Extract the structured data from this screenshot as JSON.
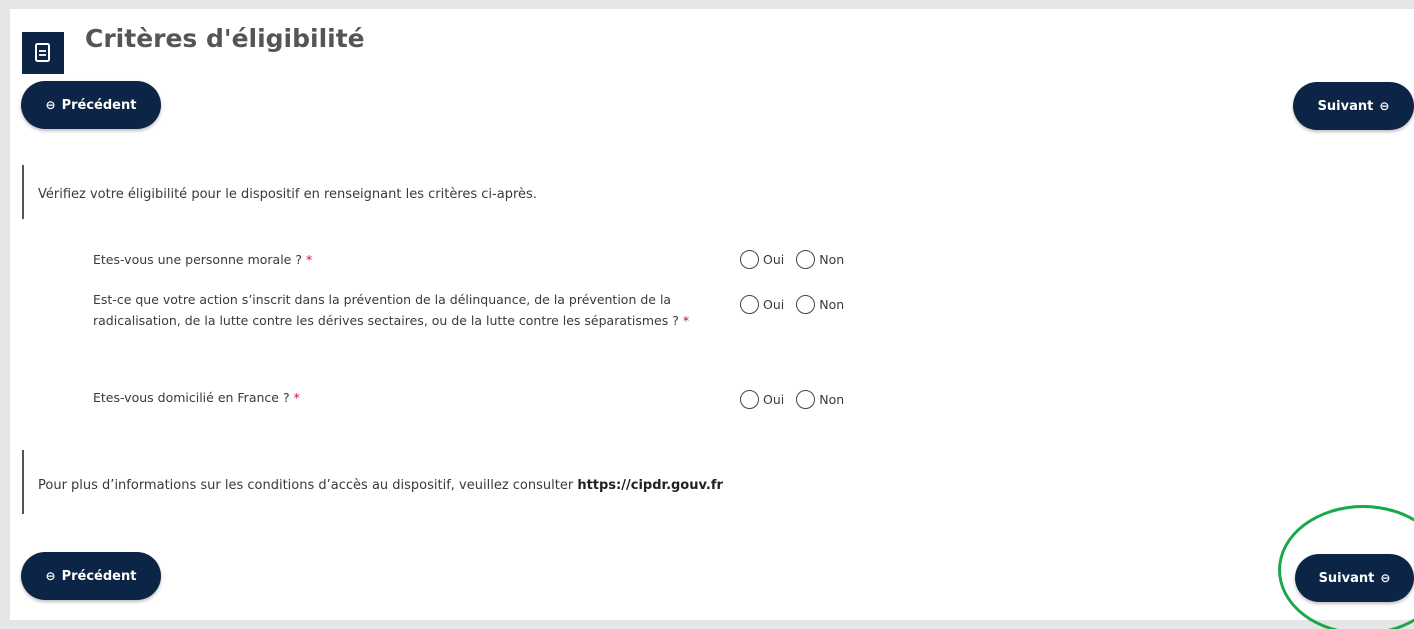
{
  "header": {
    "title": "Critères d'éligibilité",
    "icon": "document-icon"
  },
  "nav": {
    "prev_label": "Précédent",
    "next_label": "Suivant",
    "prev_glyph": "⊖",
    "next_glyph": "⊖"
  },
  "intro": {
    "text": "Vérifiez votre éligibilité pour le dispositif en renseignant les critères ci-après."
  },
  "questions": [
    {
      "text": "Etes-vous une personne morale ?",
      "required_mark": "*",
      "option_yes": "Oui",
      "option_no": "Non"
    },
    {
      "text": "Est-ce que votre action s’inscrit dans la prévention de la délinquance, de la prévention de la radicalisation, de la lutte contre les dérives sectaires, ou de la lutte contre les séparatismes ?",
      "required_mark": "*",
      "option_yes": "Oui",
      "option_no": "Non"
    },
    {
      "text": "Etes-vous domicilié en France ?",
      "required_mark": "*",
      "option_yes": "Oui",
      "option_no": "Non"
    }
  ],
  "info": {
    "text": "Pour plus d’informations sur les conditions d’accès au dispositif, veuillez consulter ",
    "link": "https://cipdr.gouv.fr"
  },
  "colors": {
    "primary": "#0c2446",
    "required": "#c8102e",
    "highlight": "#1aa84b"
  }
}
